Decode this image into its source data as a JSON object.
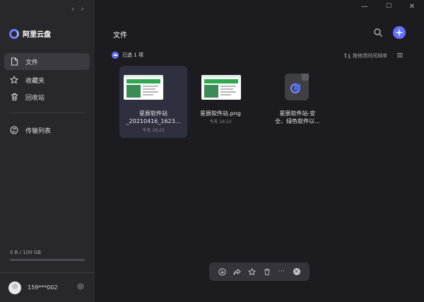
{
  "app": {
    "name": "阿里云盘"
  },
  "nav": {
    "back": "‹",
    "forward": "›"
  },
  "sidebar": {
    "items": [
      {
        "label": "文件",
        "icon": "file-icon",
        "active": true
      },
      {
        "label": "收藏夹",
        "icon": "star-icon",
        "active": false
      },
      {
        "label": "回收站",
        "icon": "trash-icon",
        "active": false
      },
      {
        "label": "传输列表",
        "icon": "transfer-icon",
        "active": false
      }
    ],
    "storage": {
      "text": "0 B / 100 GB",
      "used_fraction": 0.0
    },
    "user": {
      "name": "159***002"
    }
  },
  "window": {
    "minimize": "—",
    "maximize": "☐",
    "close": "✕"
  },
  "main": {
    "title": "文件",
    "selection_text": "已选 1 项",
    "sort_label": "按修改时间排序",
    "files": [
      {
        "name_line1": "星辰软件站",
        "name_line2": "_20210416_1623...",
        "time": "今天 16:23",
        "type": "image",
        "selected": true
      },
      {
        "name_line1": "星辰软件站.png",
        "name_line2": "",
        "time": "今天 16:23",
        "type": "image",
        "selected": false
      },
      {
        "name_line1": "星辰软件站-安",
        "name_line2": "全、绿色软件以...",
        "time": "",
        "type": "document",
        "selected": false
      }
    ]
  },
  "toolbar": {
    "buttons": [
      "download-icon",
      "share-icon",
      "star-icon",
      "trash-icon",
      "more-icon",
      "close-icon"
    ],
    "more_label": "···",
    "close_label": "×"
  },
  "colors": {
    "accent": "#6370ff",
    "sidebar_bg": "#28282c",
    "main_bg": "#1c1c20",
    "selected_card": "#2e3040"
  }
}
